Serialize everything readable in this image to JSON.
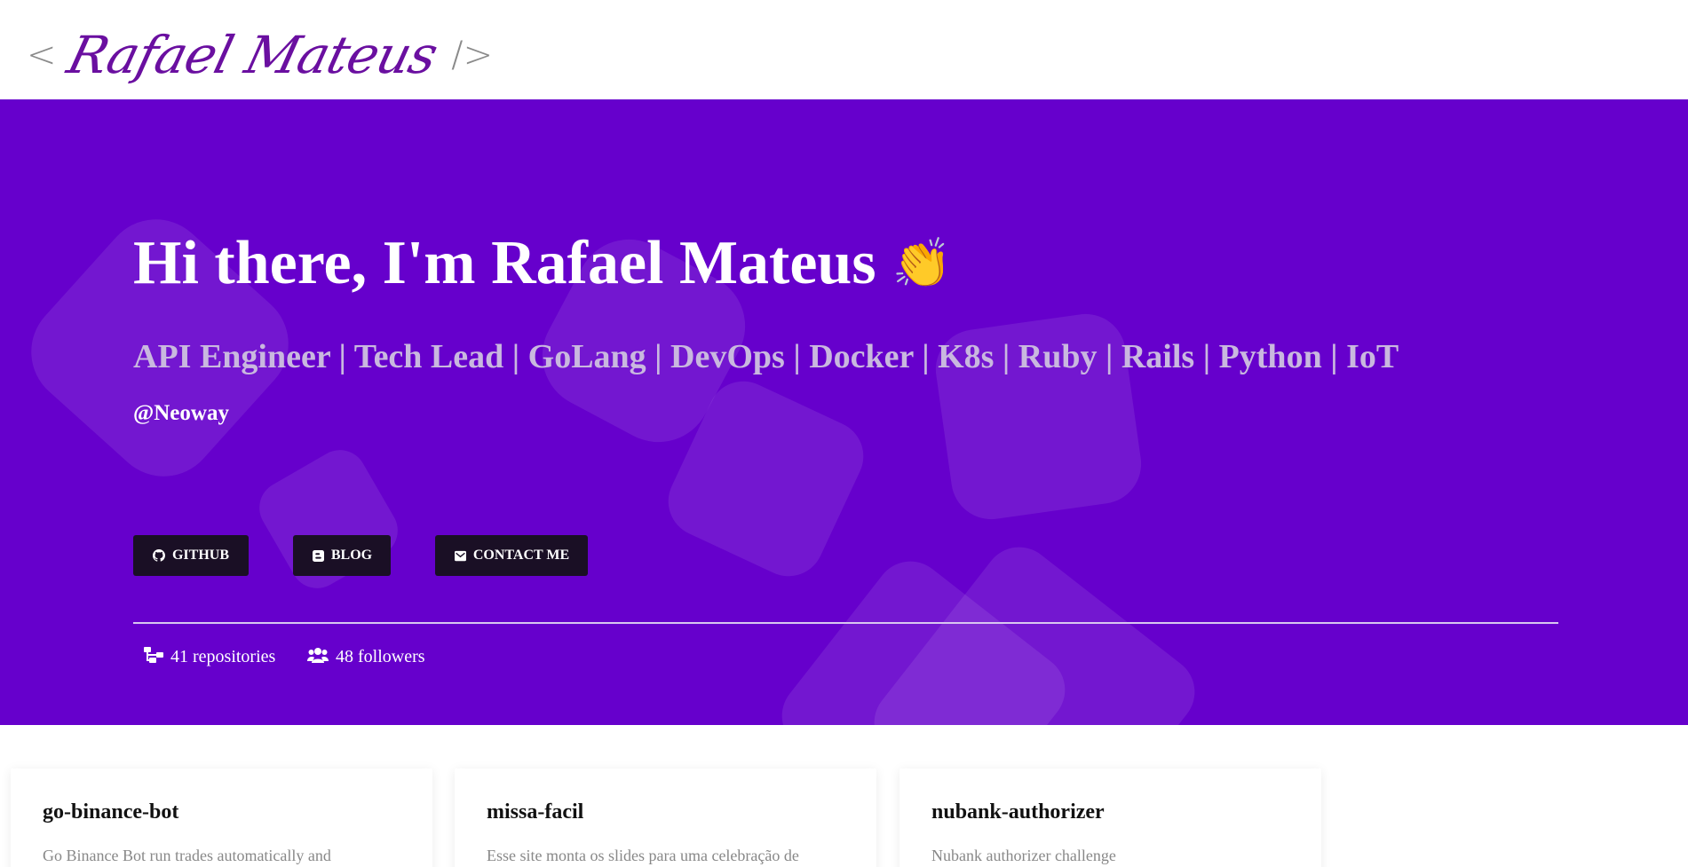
{
  "header": {
    "logo_left": "<",
    "logo_name": "Rafael Mateus",
    "logo_right": "/>"
  },
  "hero": {
    "title": "Hi there, I'm Rafael Mateus",
    "wave_icon": "👏",
    "subtitle": "API Engineer | Tech Lead | GoLang | DevOps | Docker | K8s | Ruby | Rails | Python | IoT",
    "company": "@Neoway",
    "buttons": {
      "github": "GITHUB",
      "blog": "BLOG",
      "contact": "CONTACT ME"
    },
    "stats": {
      "repositories": "41 repositories",
      "followers": "48 followers"
    },
    "background_color": "#6600cc"
  },
  "repos": [
    {
      "name": "go-binance-bot",
      "description": "Go Binance Bot run trades automatically and"
    },
    {
      "name": "missa-facil",
      "description": "Esse site monta os slides para uma celebração de"
    },
    {
      "name": "nubank-authorizer",
      "description": "Nubank authorizer challenge"
    }
  ]
}
